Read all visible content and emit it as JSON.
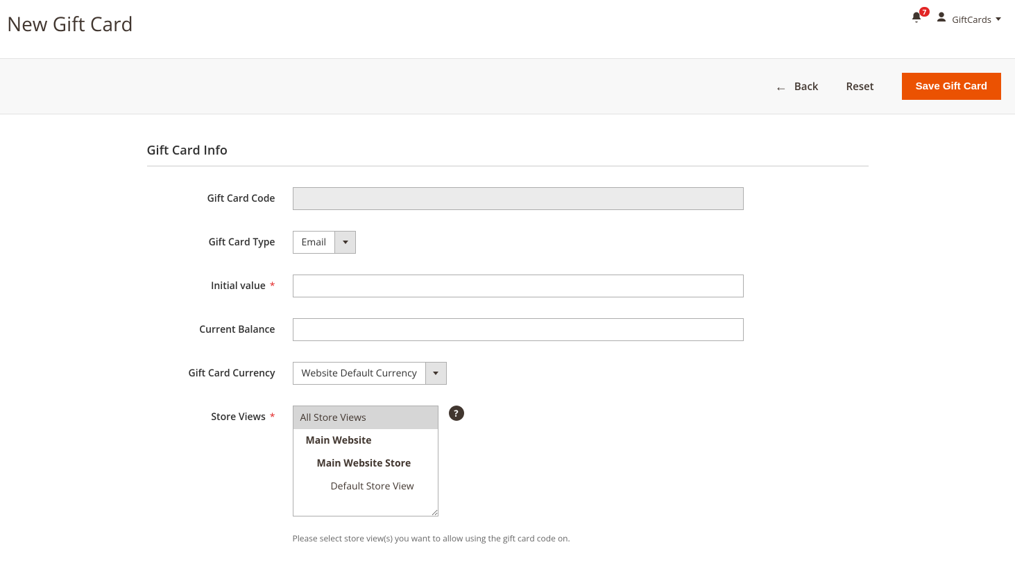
{
  "header": {
    "title": "New Gift Card",
    "notif_count": "7",
    "user_name": "GiftCards"
  },
  "actions": {
    "back": "Back",
    "reset": "Reset",
    "save": "Save Gift Card"
  },
  "section": {
    "title": "Gift Card Info"
  },
  "fields": {
    "code": {
      "label": "Gift Card Code",
      "value": ""
    },
    "type": {
      "label": "Gift Card Type",
      "value": "Email"
    },
    "initial": {
      "label": "Initial value",
      "value": ""
    },
    "balance": {
      "label": "Current Balance",
      "value": ""
    },
    "currency": {
      "label": "Gift Card Currency",
      "value": "Website Default Currency"
    },
    "stores": {
      "label": "Store Views",
      "options": {
        "all": "All Store Views",
        "website": "Main Website",
        "store": "Main Website Store",
        "view": "Default Store View"
      },
      "hint": "Please select store view(s) you want to allow using the gift card code on."
    }
  }
}
